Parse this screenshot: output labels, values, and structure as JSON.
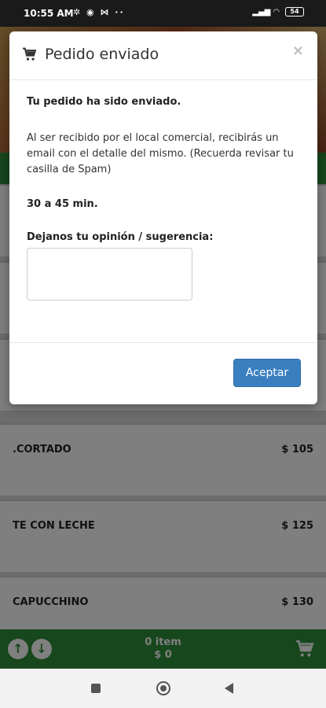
{
  "status_bar": {
    "time": "10:55 AM",
    "left_icons": "✲ ◉ ⋈ ··",
    "battery": "54"
  },
  "modal": {
    "title": "Pedido enviado",
    "close_label": "×",
    "sent_message": "Tu pedido ha sido enviado.",
    "info_message": "Al ser recibido por el local comercial, recibirás un email con el detalle del mismo. (Recuerda revisar tu casilla de Spam)",
    "delivery_time": "30 a 45 min.",
    "feedback_label": "Dejanos tu opinión / sugerencia:",
    "feedback_value": "",
    "accept_label": "Aceptar"
  },
  "menu": {
    "items": [
      {
        "name": ".CORTADO",
        "price": "$ 105"
      },
      {
        "name": "TE CON LECHE",
        "price": "$ 125"
      },
      {
        "name": "CAPUCCHINO",
        "price": "$ 130"
      }
    ]
  },
  "cart_bar": {
    "items_count": "0 item",
    "total": "$ 0"
  },
  "colors": {
    "brand_green": "#2f8f3a",
    "accept_blue": "#3a7fc0"
  }
}
